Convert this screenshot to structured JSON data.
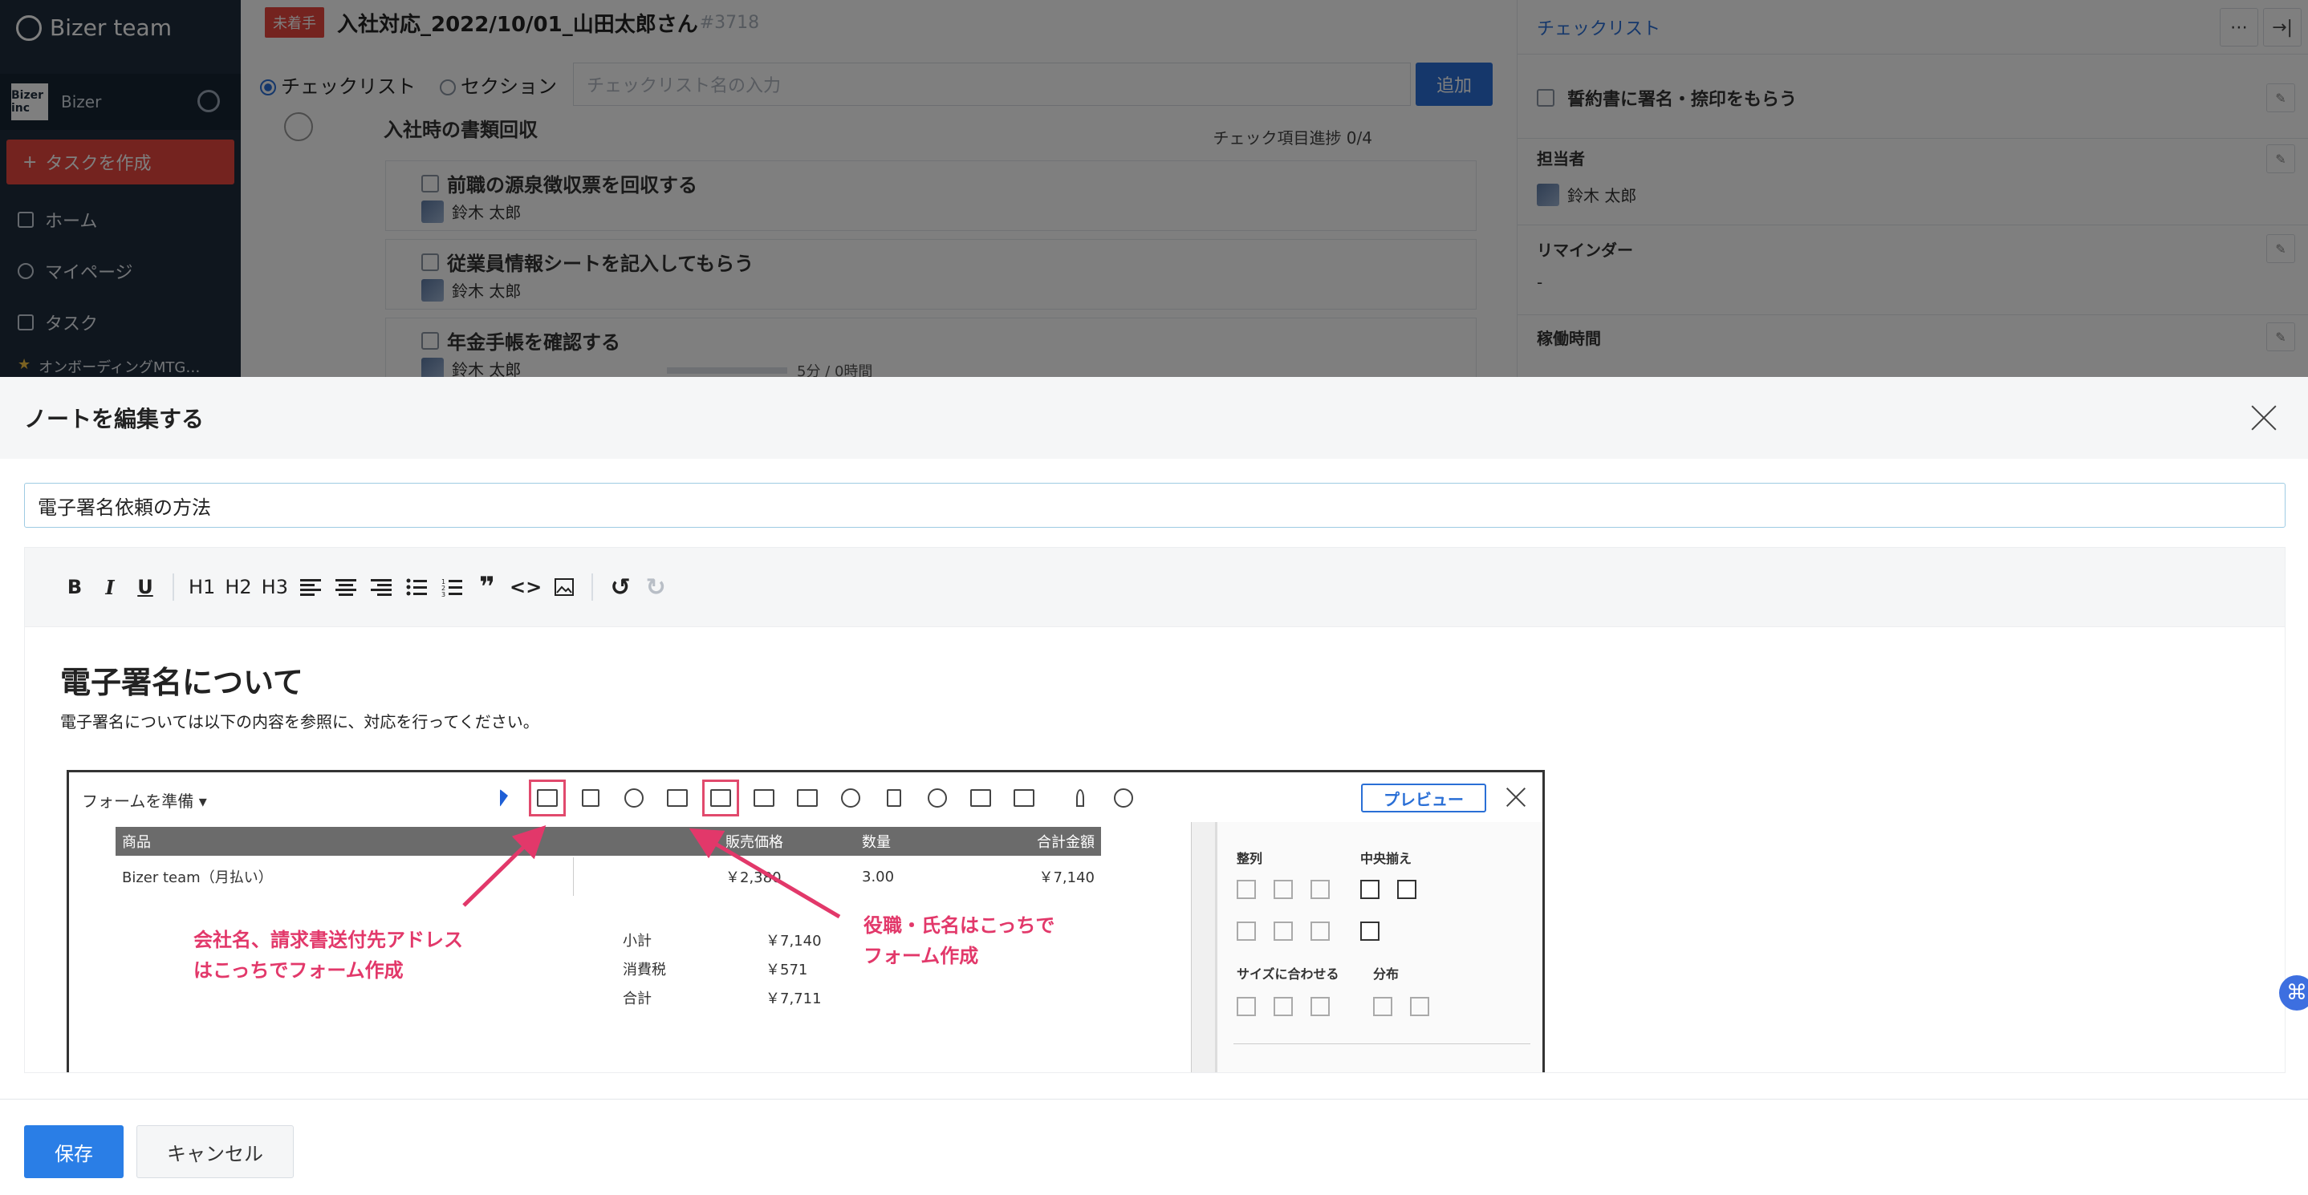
{
  "sidebar": {
    "brand": "Bizer team",
    "org_logo": "Bizer inc",
    "org_name": "Bizer",
    "create_label": "タスクを作成",
    "nav": [
      "ホーム",
      "マイページ",
      "タスク"
    ],
    "favorite": "オンボーディングMTG…"
  },
  "task": {
    "status": "未着手",
    "title": "入社対応_2022/10/01_山田太郎さん",
    "id": "#3718"
  },
  "check_toolbar": {
    "radio_checklist": "チェックリスト",
    "radio_section": "セクション",
    "placeholder": "チェックリスト名の入力",
    "add_label": "追加"
  },
  "section": {
    "title": "入社時の書類回収",
    "progress": "チェック項目進捗 0/4",
    "items": [
      {
        "label": "前職の源泉徴収票を回収する",
        "user": "鈴木 太郎"
      },
      {
        "label": "従業員情報シートを記入してもらう",
        "user": "鈴木 太郎"
      },
      {
        "label": "年金手帳を確認する",
        "user": "鈴木 太郎",
        "meta": "5分 / 0時間"
      }
    ]
  },
  "right_panel": {
    "tab": "チェックリスト",
    "item_title": "誓約書に署名・捺印をもらう",
    "assignee_label": "担当者",
    "assignee": "鈴木 太郎",
    "reminder_label": "リマインダー",
    "reminder_value": "-",
    "work_time_label": "稼働時間"
  },
  "modal": {
    "title": "ノートを編集する",
    "note_title": "電子署名依頼の方法",
    "toolbar": {
      "bold": "B",
      "italic": "I",
      "underline": "U",
      "h1": "H1",
      "h2": "H2",
      "h3": "H3"
    },
    "doc_heading": "電子署名について",
    "doc_paragraph": "電子署名については以下の内容を参照に、対応を行ってください。",
    "save_label": "保存",
    "cancel_label": "キャンセル"
  },
  "embedded_screenshot": {
    "form_menu": "フォームを準備 ▾",
    "preview": "プレビュー",
    "table_headers": [
      "商品",
      "販売価格",
      "数量",
      "合計金額"
    ],
    "row": [
      "Bizer team（月払い）",
      "￥2,380",
      "3.00",
      "￥7,140"
    ],
    "subtotal_label": "小計",
    "subtotal": "￥7,140",
    "tax_label": "消費税",
    "tax": "￥571",
    "total_label": "合計",
    "total": "￥7,711",
    "side": {
      "align": "整列",
      "center": "中央揃え",
      "fit": "サイズに合わせる",
      "distribute": "分布"
    },
    "annotation_left": [
      "会社名、請求書送付先アドレス",
      "はこっちでフォーム作成"
    ],
    "annotation_right": [
      "役職・氏名はこっちで",
      "フォーム作成"
    ]
  },
  "colors": {
    "accent": "#2a6fd6",
    "danger": "#e8473f",
    "annotation": "#e2386a"
  }
}
